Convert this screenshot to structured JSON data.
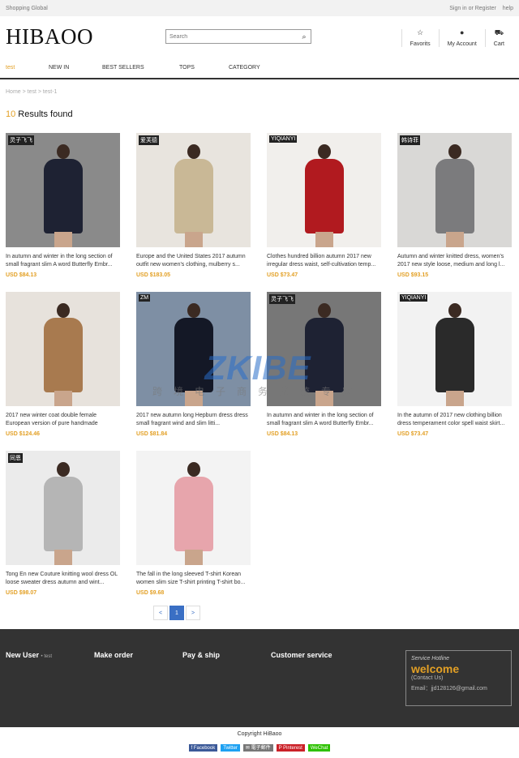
{
  "topbar": {
    "left": "Shopping Global",
    "signin": "Sign in or Register",
    "help": "help"
  },
  "header": {
    "logo": "HIBAOO",
    "search_placeholder": "Search",
    "favorits": "Favorits",
    "account": "My Account",
    "cart": "Cart"
  },
  "nav": [
    "test",
    "NEW IN",
    "BEST SELLERS",
    "TOPS",
    "CATEGORY"
  ],
  "breadcrumb": "Home > test > test-1",
  "results": {
    "count": "10",
    "label": " Results found"
  },
  "products": [
    {
      "title": "In autumn and winter in the long section of small fragrant slim A word Butterfly Embr...",
      "price": "USD $84.13",
      "bg": "#8a8a8a",
      "dress": "#1e2233",
      "badge": "灵子飞飞"
    },
    {
      "title": "Europe and the United States 2017 autumn outfit new women's clothing, mulberry s...",
      "price": "USD $183.05",
      "bg": "#e8e4de",
      "dress": "#c9b896",
      "badge": "爱芙德"
    },
    {
      "title": "Clothes hundred billion autumn 2017 new irregular dress waist, self-cultivation temp...",
      "price": "USD $73.47",
      "bg": "#f1efec",
      "dress": "#b11a1f",
      "badge": "YIQIANYI"
    },
    {
      "title": "Autumn and winter knitted dress, women's 2017 new style loose, medium and long l...",
      "price": "USD $93.15",
      "bg": "#d9d8d6",
      "dress": "#7b7b7d",
      "badge": "韩诗菲"
    },
    {
      "title": "2017 new winter coat double female European version of pure handmade cashmer...",
      "price": "USD $124.46",
      "bg": "#e7e2dc",
      "dress": "#a87a4f",
      "badge": ""
    },
    {
      "title": "2017 new autumn long Hepburn dress dress small fragrant wind and slim litti...",
      "price": "USD $81.84",
      "bg": "#7e8fa4",
      "dress": "#141826",
      "badge": "ZM"
    },
    {
      "title": "In autumn and winter in the long section of small fragrant slim A word Butterfly Embr...",
      "price": "USD $84.13",
      "bg": "#777777",
      "dress": "#1e2233",
      "badge": "灵子飞飞"
    },
    {
      "title": "In the autumn of 2017 new clothing billion dress temperament color spell waist skirt...",
      "price": "USD $73.47",
      "bg": "#f2f2f2",
      "dress": "#2a2a2a",
      "badge": "YIQIANYI"
    },
    {
      "title": "Tong En new Couture knitting wool dress OL loose sweater dress autumn and wint...",
      "price": "USD $98.07",
      "bg": "#ebebeb",
      "dress": "#b5b5b5",
      "badge": "同恩"
    },
    {
      "title": "The fall in the long sleeved T-shirt Korean women slim size T-shirt printing T-shirt bo...",
      "price": "USD $9.68",
      "bg": "#f3f3f3",
      "dress": "#e7a5ac",
      "badge": ""
    }
  ],
  "pager": {
    "prev": "<",
    "current": "1",
    "next": ">"
  },
  "watermark": {
    "main": "ZKIBE",
    "cn": "跨境电子商务系统专家"
  },
  "footer": {
    "col1": "New User",
    "col1_sub": "• test",
    "col2": "Make order",
    "col3": "Pay & ship",
    "col4": "Customer service",
    "hotline_title": "Service Hotline",
    "hotline_welcome": "welcome",
    "hotline_contact": "(Contact Us)",
    "hotline_email": "Email：jjd128126@gmail.com"
  },
  "copyright": "Copyright HiBaoo",
  "social": [
    {
      "label": "f Facebook",
      "color": "#3b5998"
    },
    {
      "label": "Twitter",
      "color": "#1da1f2"
    },
    {
      "label": "✉ 電子郵件",
      "color": "#777777"
    },
    {
      "label": "P Pinterest",
      "color": "#cb2027"
    },
    {
      "label": "WeChat",
      "color": "#2dc100"
    }
  ]
}
